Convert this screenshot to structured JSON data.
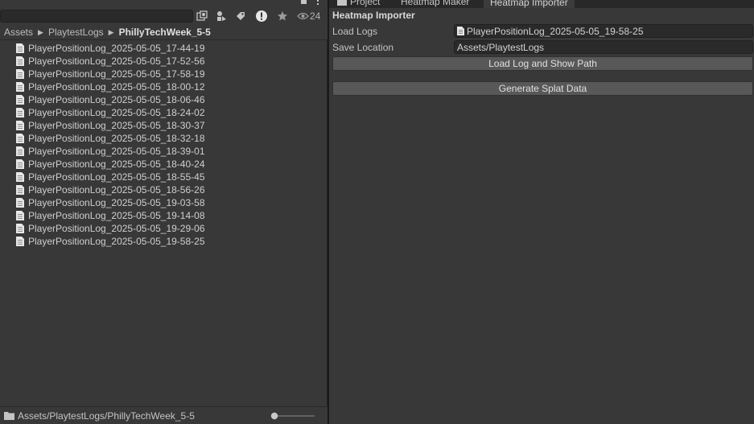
{
  "project_panel": {
    "search": {
      "value": "",
      "placeholder": ""
    },
    "toolbar_icons": [
      "create-icon",
      "search-by-type-icon",
      "label-icon",
      "error-icon",
      "favorite-icon",
      "visibility-icon"
    ],
    "hidden_count": "24",
    "breadcrumb": [
      "Assets",
      "PlaytestLogs",
      "PhillyTechWeek_5-5"
    ],
    "files": [
      "PlayerPositionLog_2025-05-05_17-44-19",
      "PlayerPositionLog_2025-05-05_17-52-56",
      "PlayerPositionLog_2025-05-05_17-58-19",
      "PlayerPositionLog_2025-05-05_18-00-12",
      "PlayerPositionLog_2025-05-05_18-06-46",
      "PlayerPositionLog_2025-05-05_18-24-02",
      "PlayerPositionLog_2025-05-05_18-30-37",
      "PlayerPositionLog_2025-05-05_18-32-18",
      "PlayerPositionLog_2025-05-05_18-39-01",
      "PlayerPositionLog_2025-05-05_18-40-24",
      "PlayerPositionLog_2025-05-05_18-55-45",
      "PlayerPositionLog_2025-05-05_18-56-26",
      "PlayerPositionLog_2025-05-05_19-03-58",
      "PlayerPositionLog_2025-05-05_19-14-08",
      "PlayerPositionLog_2025-05-05_19-29-06",
      "PlayerPositionLog_2025-05-05_19-58-25"
    ],
    "footer_path": "Assets/PlaytestLogs/PhillyTechWeek_5-5",
    "zoom_level": 0
  },
  "tabs": [
    {
      "label": "Project",
      "active": false
    },
    {
      "label": "Heatmap Maker",
      "active": false
    },
    {
      "label": "Heatmap Importer",
      "active": true
    }
  ],
  "importer": {
    "title": "Heatmap Importer",
    "load_logs_label": "Load Logs",
    "load_logs_value": "PlayerPositionLog_2025-05-05_19-58-25",
    "save_location_label": "Save Location",
    "save_location_value": "Assets/PlaytestLogs",
    "load_button": "Load Log and Show Path",
    "generate_button": "Generate Splat Data"
  },
  "colors": {
    "panel_bg": "#383838",
    "field_bg": "#2a2a2a",
    "button_bg": "#585858",
    "active_tab_accent": "#3a79bb"
  }
}
